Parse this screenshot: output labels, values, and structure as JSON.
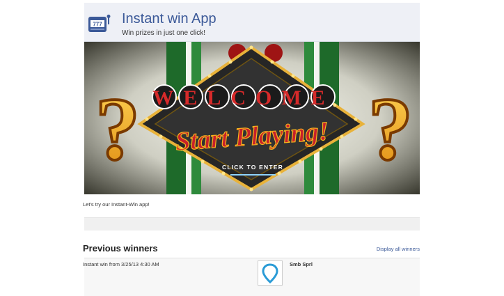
{
  "header": {
    "title": "Instant win App",
    "subtitle": "Win prizes in just one click!",
    "logo_icon": "slot-machine-icon",
    "logo_text": "777"
  },
  "banner": {
    "welcome": "WELCOME",
    "headline": "Start Playing!",
    "cta": "CLICK TO ENTER",
    "question_mark": "?",
    "colors": {
      "marquee_red": "#c8202a",
      "gold": "#f5b51e",
      "cta_blue": "#8fd3ff",
      "green_stripe": "#1e6a2a"
    }
  },
  "intro_text": "Let's try our Instant-Win app!",
  "previous_winners": {
    "title": "Previous winners",
    "display_all_label": "Display all winners",
    "entries": [
      {
        "text": "Instant win from 3/25/13 4:30 AM",
        "name": "Smb Sprl",
        "avatar_icon": "map-pin-icon"
      }
    ]
  }
}
